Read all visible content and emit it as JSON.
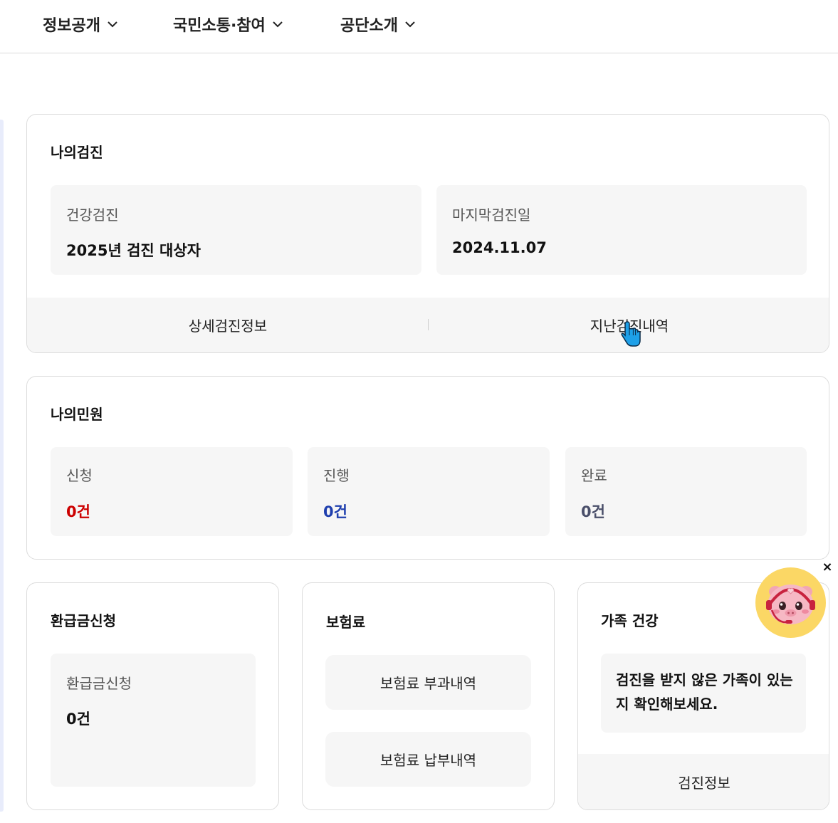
{
  "nav": {
    "items": [
      {
        "label": "정보공개",
        "icon": "chevron-down-icon"
      },
      {
        "label": "국민소통·참여",
        "icon": "chevron-down-icon"
      },
      {
        "label": "공단소개",
        "icon": "chevron-down-icon"
      }
    ]
  },
  "checkup": {
    "title": "나의검진",
    "health_label": "건강검진",
    "health_value": "2025년 검진 대상자",
    "last_label": "마지막검진일",
    "last_value": "2024.11.07",
    "detail_button": "상세검진정보",
    "history_button": "지난검진내역"
  },
  "petition": {
    "title": "나의민원",
    "items": [
      {
        "label": "신청",
        "value": "0건",
        "color": "#cc0000"
      },
      {
        "label": "진행",
        "value": "0건",
        "color": "#1f3fae"
      },
      {
        "label": "완료",
        "value": "0건",
        "color": "#4a4f6a"
      }
    ]
  },
  "refund": {
    "title": "환급금신청",
    "label": "환급금신청",
    "value": "0건"
  },
  "premium": {
    "title": "보험료",
    "charge_button": "보험료 부과내역",
    "payment_button": "보험료 납부내역"
  },
  "family": {
    "title": "가족 건강",
    "message": "검진을 받지 않은 가족이 있는지 확인해보세요.",
    "info_button": "검진정보"
  },
  "chatbot": {
    "close_label": "×",
    "icon": "chatbot-mascot-icon",
    "bg_color": "#fbd765"
  }
}
